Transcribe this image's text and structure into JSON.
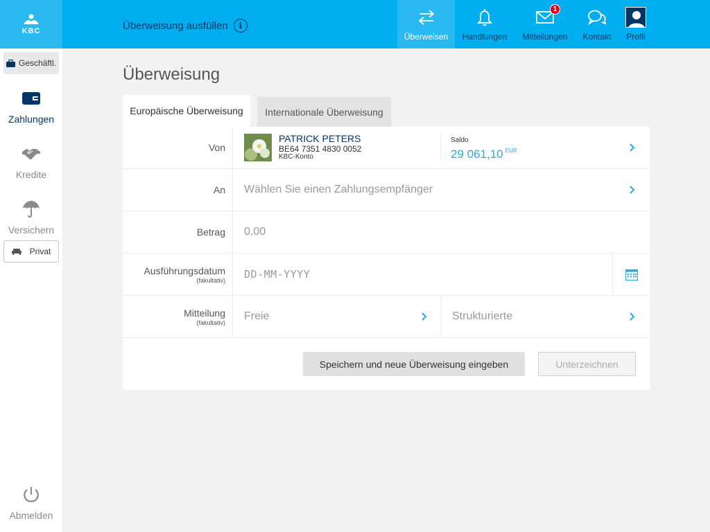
{
  "header": {
    "logo_text": "KBC",
    "caption": "Überweisung ausfüllen",
    "nav": [
      {
        "label": "Überweisen",
        "icon": "transfer-arrows-icon",
        "active": true
      },
      {
        "label": "Handlungen",
        "icon": "bell-icon"
      },
      {
        "label": "Mitteilungen",
        "icon": "envelope-icon",
        "badge": "1"
      },
      {
        "label": "Kontakt",
        "icon": "chat-bubbles-icon"
      },
      {
        "label": "Profil",
        "icon": "profile-avatar-icon"
      }
    ]
  },
  "sidebar": {
    "business_label": "Geschäftl.",
    "items": [
      {
        "label": "Zahlungen",
        "icon": "wallet-icon",
        "active": true
      },
      {
        "label": "Kredite",
        "icon": "handshake-icon"
      },
      {
        "label": "Versichern",
        "icon": "umbrella-icon"
      }
    ],
    "private_label": "Privat",
    "logout_label": "Abmelden"
  },
  "page": {
    "title": "Überweisung",
    "tabs": [
      {
        "label": "Europäische Überweisung",
        "active": true
      },
      {
        "label": "Internationale Überweisung"
      }
    ]
  },
  "form": {
    "von_label": "Von",
    "account": {
      "name": "PATRICK PETERS",
      "iban": "BE64 7351 4830 0052",
      "type": "KBC-Konto",
      "saldo_label": "Saldo",
      "saldo_value": "29 061,10",
      "saldo_currency": "EUR"
    },
    "an_label": "An",
    "an_placeholder": "Wählen Sie einen Zahlungsempfänger",
    "betrag_label": "Betrag",
    "betrag_placeholder": "0,00",
    "datum_label": "Ausführungsdatum",
    "datum_optional": "(fakultativ)",
    "datum_placeholder": "DD-MM-YYYY",
    "mitteilung_label": "Mitteilung",
    "mitteilung_optional": "(fakultativ)",
    "mitteilung_free": "Freie",
    "mitteilung_structured": "Strukturierte"
  },
  "buttons": {
    "save_new": "Speichern und neue Überweisung eingeben",
    "sign": "Unterzeichnen"
  },
  "colors": {
    "header_blue": "#00aeef",
    "navy": "#003665",
    "accent": "#29a9e0",
    "badge_red": "#e2001a"
  }
}
